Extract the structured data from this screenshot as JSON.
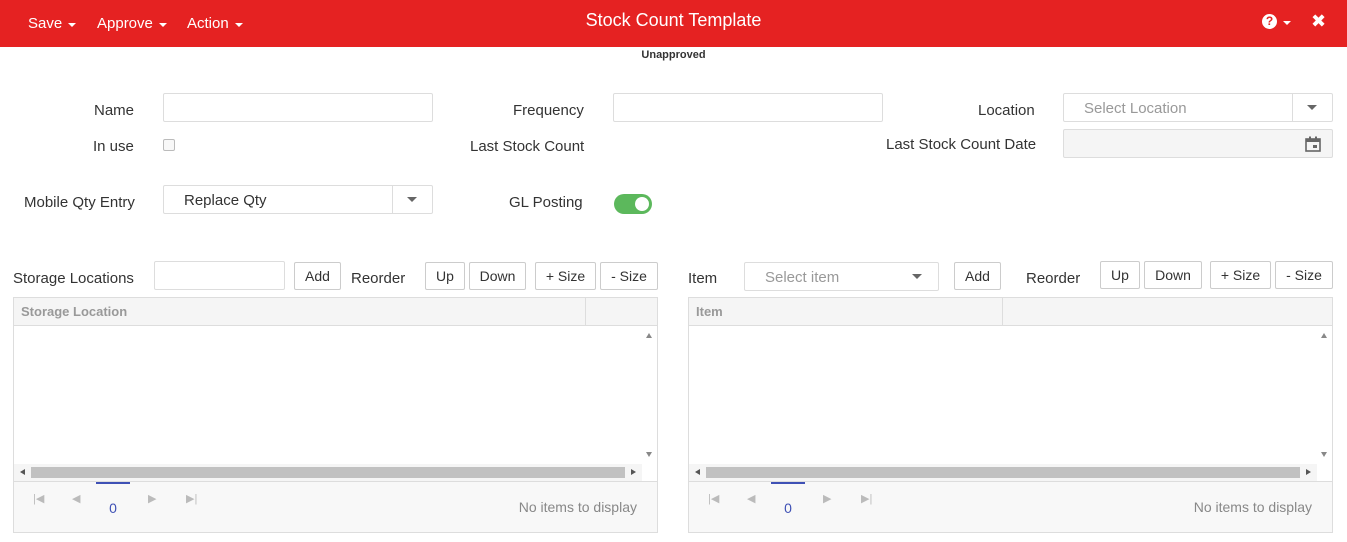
{
  "header": {
    "menus": [
      "Save",
      "Approve",
      "Action"
    ],
    "title": "Stock Count Template",
    "help_icon": "question-circle-icon",
    "close_icon": "close-icon"
  },
  "status": "Unapproved",
  "form": {
    "name_label": "Name",
    "name_value": "",
    "frequency_label": "Frequency",
    "frequency_value": "",
    "location_label": "Location",
    "location_placeholder": "Select Location",
    "in_use_label": "In use",
    "in_use_checked": false,
    "last_stock_count_label": "Last Stock Count",
    "last_stock_count_date_label": "Last Stock Count Date",
    "last_stock_count_date_value": "",
    "mobile_qty_entry_label": "Mobile Qty Entry",
    "mobile_qty_entry_value": "Replace Qty",
    "gl_posting_label": "GL Posting",
    "gl_posting_on": true
  },
  "storage_panel": {
    "label": "Storage Locations",
    "input_value": "",
    "add_label": "Add",
    "reorder_label": "Reorder",
    "up_label": "Up",
    "down_label": "Down",
    "plus_size_label": "+ Size",
    "minus_size_label": "- Size",
    "columns": [
      "Storage Location",
      ""
    ],
    "page": "0",
    "empty_text": "No items to display"
  },
  "item_panel": {
    "label": "Item",
    "select_placeholder": "Select item",
    "add_label": "Add",
    "reorder_label": "Reorder",
    "up_label": "Up",
    "down_label": "Down",
    "plus_size_label": "+ Size",
    "minus_size_label": "- Size",
    "columns": [
      "Item",
      ""
    ],
    "page": "0",
    "empty_text": "No items to display"
  },
  "colors": {
    "header_bg": "#e52222",
    "toggle_on": "#5cb85c",
    "pager_active": "#3f51b5"
  }
}
